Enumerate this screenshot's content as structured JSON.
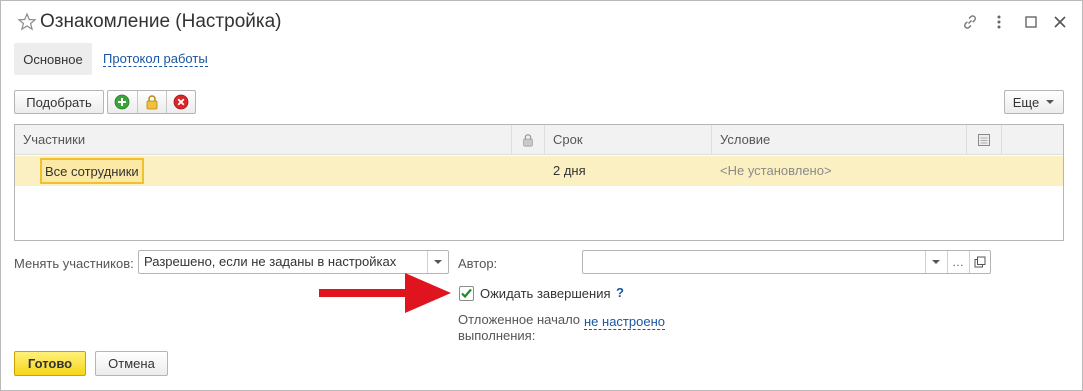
{
  "window": {
    "title": "Ознакомление (Настройка)"
  },
  "tabs": [
    {
      "label": "Основное",
      "active": true
    },
    {
      "label": "Протокол работы",
      "active": false
    }
  ],
  "toolbar": {
    "pick_label": "Подобрать",
    "more_label": "Еще"
  },
  "table": {
    "columns": [
      "Участники",
      "",
      "Срок",
      "Условие",
      ""
    ],
    "rows": [
      {
        "participant": "Все сотрудники",
        "term": "2 дня",
        "condition": "<Не установлено>"
      }
    ]
  },
  "form": {
    "change_participants_label": "Менять участников:",
    "change_participants_value": "Разрешено, если не заданы в настройках",
    "author_label": "Автор:",
    "author_value": "",
    "wait_completion_label": "Ожидать завершения",
    "wait_completion_checked": true,
    "help_mark": "?",
    "deferred_start_label_line1": "Отложенное начало",
    "deferred_start_label_line2": "выполнения:",
    "deferred_start_value": "не настроено"
  },
  "footer": {
    "ok_label": "Готово",
    "cancel_label": "Отмена"
  },
  "colors": {
    "accent_yellow": "#f7d51a",
    "selected_row": "#fbf0c2",
    "link_blue": "#1a55a3",
    "annotation_arrow": "#e0141e"
  }
}
